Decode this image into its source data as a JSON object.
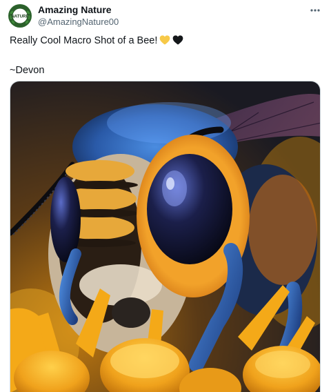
{
  "author": {
    "display_name": "Amazing Nature",
    "handle": "@AmazingNature00",
    "avatar_text": "NATURE",
    "avatar_icon": "nature-badge-logo"
  },
  "actions": {
    "more_icon": "more-horizontal-icon"
  },
  "tweet": {
    "text_line1": "Really Cool Macro Shot of a Bee!",
    "text_line2": "~Devon",
    "emojis": [
      "yellow-heart-icon",
      "black-heart-icon"
    ]
  },
  "colors": {
    "text_primary": "#0f1419",
    "text_secondary": "#536471",
    "yellow_heart": "#f7c948",
    "black_heart": "#14171a"
  }
}
